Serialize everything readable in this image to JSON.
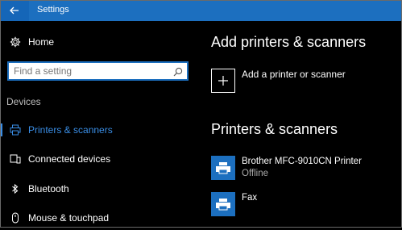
{
  "window": {
    "title": "Settings"
  },
  "sidebar": {
    "home_label": "Home",
    "search": {
      "placeholder": "Find a setting",
      "value": ""
    },
    "section_label": "Devices",
    "items": [
      {
        "label": "Printers & scanners",
        "icon": "printer-icon",
        "active": true
      },
      {
        "label": "Connected devices",
        "icon": "connected-devices-icon",
        "active": false
      },
      {
        "label": "Bluetooth",
        "icon": "bluetooth-icon",
        "active": false
      },
      {
        "label": "Mouse & touchpad",
        "icon": "mouse-icon",
        "active": false
      }
    ]
  },
  "main": {
    "add_heading": "Add printers & scanners",
    "add_button_label": "Add a printer or scanner",
    "list_heading": "Printers & scanners",
    "devices": [
      {
        "name": "Brother MFC-9010CN Printer",
        "status": "Offline",
        "icon": "printer-icon"
      },
      {
        "name": "Fax",
        "status": "",
        "icon": "fax-icon"
      }
    ]
  },
  "colors": {
    "accent": "#1c6fbf",
    "active_text": "#3a8ee6",
    "background": "#000000"
  }
}
